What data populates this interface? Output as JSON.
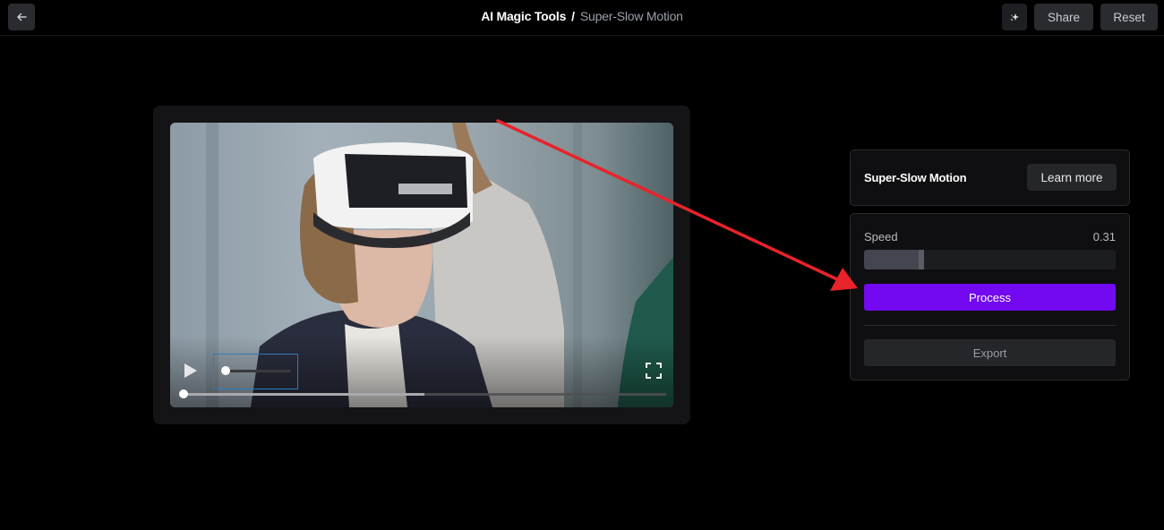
{
  "header": {
    "back_icon": "arrow-left-icon",
    "breadcrumb": {
      "root": "AI Magic Tools",
      "separator": "/",
      "current": "Super-Slow Motion"
    },
    "sparkle_icon": "sparkle-icon",
    "share_label": "Share",
    "reset_label": "Reset"
  },
  "player": {
    "play_icon": "play-icon",
    "fullscreen_icon": "fullscreen-icon",
    "volume_level": 0.0,
    "seek_position": 0.0,
    "buffered": 0.5
  },
  "tool_panel": {
    "title": "Super-Slow Motion",
    "learn_more_label": "Learn more"
  },
  "settings_panel": {
    "speed_label": "Speed",
    "speed_value": "0.31",
    "speed_fraction": 0.24,
    "process_label": "Process",
    "export_label": "Export"
  },
  "colors": {
    "accent": "#7209f0",
    "annotation_arrow": "#e8232a",
    "focus_outline": "#2a7dc0"
  }
}
